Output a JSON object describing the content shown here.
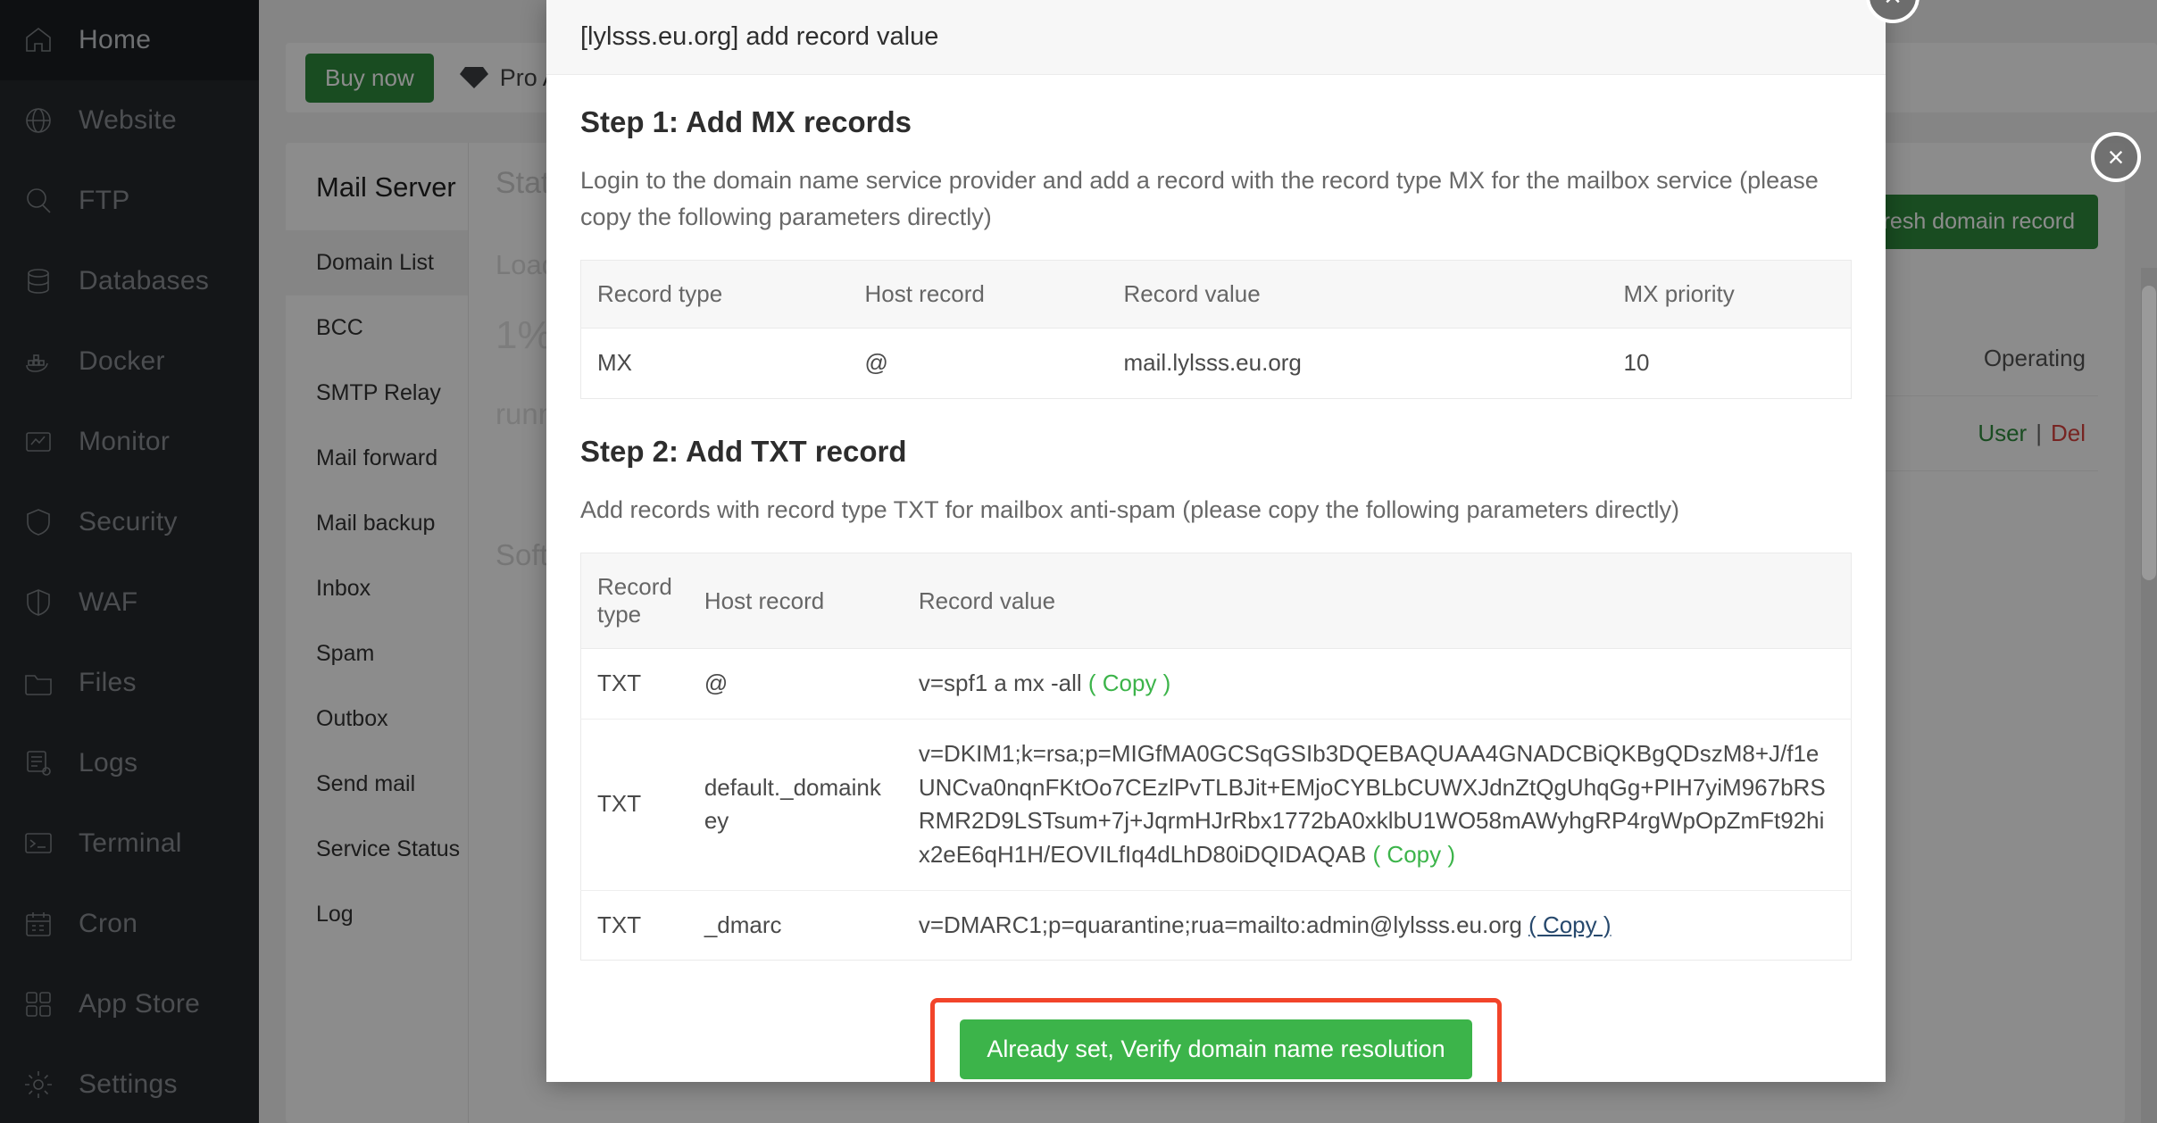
{
  "sidebar": {
    "items": [
      {
        "label": "Home",
        "icon": "home-icon",
        "active": true
      },
      {
        "label": "Website",
        "icon": "globe-icon",
        "active": false
      },
      {
        "label": "FTP",
        "icon": "ftp-icon",
        "active": false
      },
      {
        "label": "Databases",
        "icon": "database-icon",
        "active": false
      },
      {
        "label": "Docker",
        "icon": "docker-icon",
        "active": false
      },
      {
        "label": "Monitor",
        "icon": "monitor-icon",
        "active": false
      },
      {
        "label": "Security",
        "icon": "shield-icon",
        "active": false
      },
      {
        "label": "WAF",
        "icon": "waf-shield-icon",
        "active": false
      },
      {
        "label": "Files",
        "icon": "folder-icon",
        "active": false
      },
      {
        "label": "Logs",
        "icon": "logs-icon",
        "active": false
      },
      {
        "label": "Terminal",
        "icon": "terminal-icon",
        "active": false
      },
      {
        "label": "Cron",
        "icon": "calendar-icon",
        "active": false
      },
      {
        "label": "App Store",
        "icon": "grid-icon",
        "active": false
      },
      {
        "label": "Settings",
        "icon": "gear-icon",
        "active": false
      }
    ]
  },
  "topbar": {
    "buy_now": "Buy now",
    "pro_label": "Pro A"
  },
  "mail_panel": {
    "title": "Mail Server",
    "nav": [
      {
        "label": "Domain List",
        "active": true
      },
      {
        "label": "BCC",
        "active": false
      },
      {
        "label": "SMTP Relay",
        "active": false
      },
      {
        "label": "Mail forward",
        "active": false
      },
      {
        "label": "Mail backup",
        "active": false
      },
      {
        "label": "Inbox",
        "active": false
      },
      {
        "label": "Spam",
        "active": false
      },
      {
        "label": "Outbox",
        "active": false
      },
      {
        "label": "Send mail",
        "active": false
      },
      {
        "label": "Service Status",
        "active": false
      },
      {
        "label": "Log",
        "active": false
      }
    ],
    "status_heading": "Status",
    "load_status": "Load status",
    "load_percent": "1%",
    "running_text": "running smoothly",
    "software_text": "Software",
    "refresh_button": "Refresh domain record",
    "operating_header": "Operating",
    "row_actions": {
      "user": "User",
      "separator": "|",
      "delete": "Del"
    }
  },
  "modal": {
    "title": "[lylsss.eu.org] add record value",
    "close_label": "×",
    "step1": {
      "heading": "Step 1: Add MX records",
      "description": "Login to the domain name service provider and add a record with the record type MX for the mailbox service (please copy the following parameters directly)",
      "columns": [
        "Record type",
        "Host record",
        "Record value",
        "MX priority"
      ],
      "rows": [
        {
          "record_type": "MX",
          "host_record": "@",
          "record_value": "mail.lylsss.eu.org",
          "mx_priority": "10"
        }
      ]
    },
    "step2": {
      "heading": "Step 2: Add TXT record",
      "description": "Add records with record type TXT for mailbox anti-spam (please copy the following parameters directly)",
      "columns": [
        "Record type",
        "Host record",
        "Record value"
      ],
      "rows": [
        {
          "record_type": "TXT",
          "host_record": "@",
          "record_value": "v=spf1 a mx -all",
          "copy_label": "( Copy )",
          "copy_hover": false
        },
        {
          "record_type": "TXT",
          "host_record": "default._domainkey",
          "record_value": "v=DKIM1;k=rsa;p=MIGfMA0GCSqGSIb3DQEBAQUAA4GNADCBiQKBgQDszM8+J/f1eUNCva0nqnFKtOo7CEzlPvTLBJit+EMjoCYBLbCUWXJdnZtQgUhqGg+PIH7yiM967bRSRMR2D9LSTsum+7j+JqrmHJrRbx1772bA0xklbU1WO58mAWyhgRP4rgWpOpZmFt92hix2eE6qH1H/EOVILfIq4dLhD80iDQIDAQAB",
          "copy_label": "( Copy )",
          "copy_hover": false
        },
        {
          "record_type": "TXT",
          "host_record": "_dmarc",
          "record_value": "v=DMARC1;p=quarantine;rua=mailto:admin@lylsss.eu.org",
          "copy_label": "( Copy )",
          "copy_hover": true
        }
      ]
    },
    "verify_button": "Already set, Verify domain name resolution"
  },
  "colors": {
    "green": "#3cb44a",
    "dark_green": "#2e8b3c",
    "highlight_red": "#f2442a",
    "link_hover": "#27496d",
    "delete_red": "#d9433f",
    "sidebar_bg": "#25282c"
  }
}
